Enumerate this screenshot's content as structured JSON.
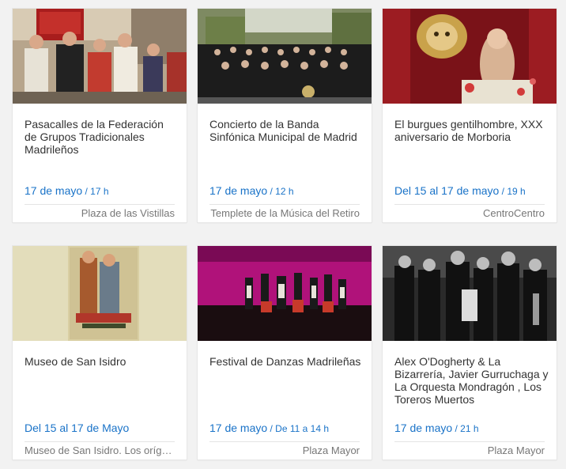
{
  "events": [
    {
      "title": "Pasacalles de la Federación de Grupos Tradicionales Madrileños",
      "date": "17 de mayo",
      "time": " / 17 h",
      "venue": "Plaza de las Vistillas",
      "image": "folk-parade-photo"
    },
    {
      "title": "Concierto de la Banda Sinfónica Municipal de Madrid",
      "date": "17 de mayo",
      "time": " / 12 h",
      "venue": "Templete de la Música del Retiro",
      "image": "symphonic-band-photo"
    },
    {
      "title": "El burgues gentilhombre, XXX aniversario de Morboria",
      "date": "Del 15 al 17 de mayo",
      "time": " / 19 h",
      "venue": "CentroCentro",
      "image": "theatre-puppet-photo"
    },
    {
      "title": "Museo de San Isidro",
      "date": "Del 15 al 17 de Mayo",
      "time": "",
      "venue": "Museo de San Isidro. Los orígenes de Madrid",
      "image": "isidro-poster-image"
    },
    {
      "title": "Festival de Danzas Madrileñas",
      "date": "17 de mayo",
      "time": " / De 11 a 14 h",
      "venue": "Plaza Mayor",
      "image": "dance-stage-photo"
    },
    {
      "title": "Alex O'Dogherty & La Bizarrería, Javier Gurruchaga y La Orquesta Mondragón , Los Toreros Muertos",
      "date": "17 de mayo",
      "time": " / 21 h",
      "venue": "Plaza Mayor",
      "image": "band-group-photo"
    }
  ],
  "colors": {
    "background": "#f2f2f2",
    "card": "#ffffff",
    "title": "#333333",
    "date": "#1a73c8",
    "venue": "#777777"
  }
}
